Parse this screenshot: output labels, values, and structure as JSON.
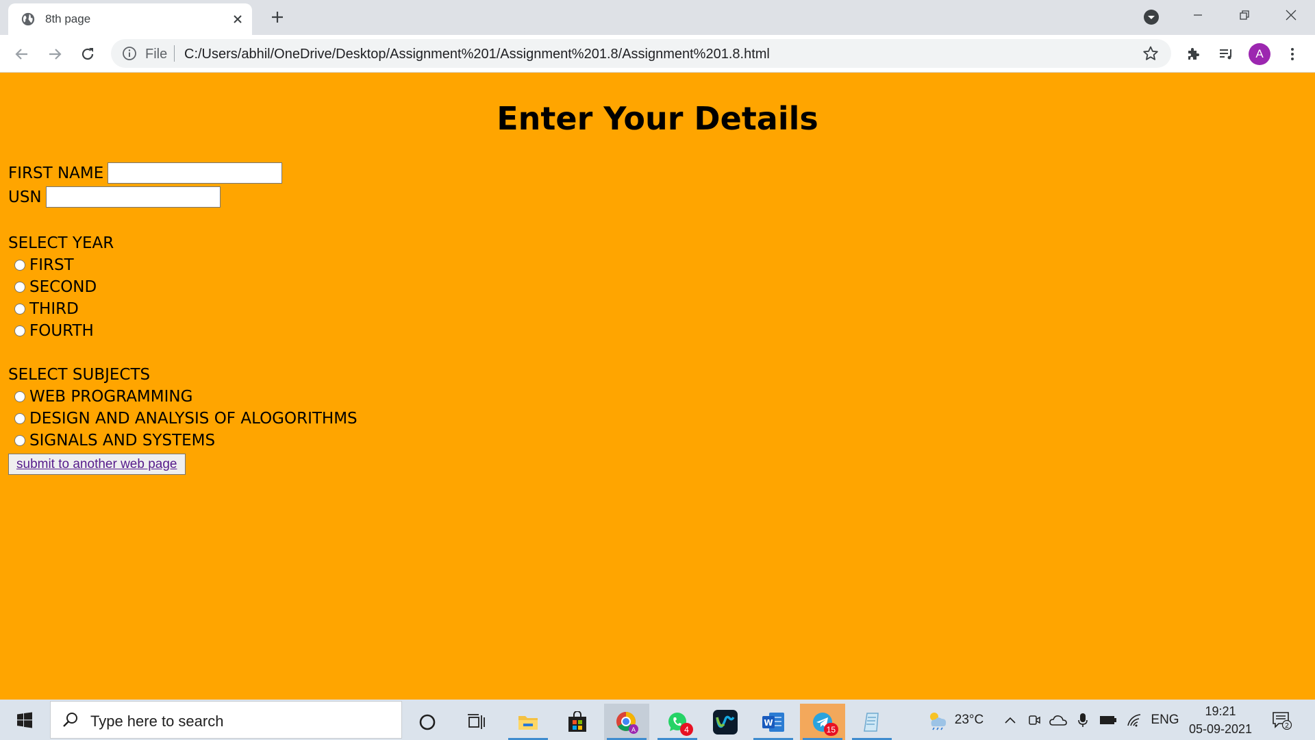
{
  "browser": {
    "tab": {
      "title": "8th page"
    },
    "address": {
      "scheme": "File",
      "url": "C:/Users/abhil/OneDrive/Desktop/Assignment%201/Assignment%201.8/Assignment%201.8.html"
    },
    "profile_initial": "A"
  },
  "page": {
    "heading": "Enter Your Details",
    "first_name_label": "FIRST NAME",
    "usn_label": "USN",
    "year_heading": "SELECT YEAR",
    "years": [
      "FIRST",
      "SECOND",
      "THIRD",
      "FOURTH"
    ],
    "subjects_heading": "SELECT SUBJECTS",
    "subjects": [
      "WEB PROGRAMMING",
      "DESIGN AND ANALYSIS OF ALOGORITHMS",
      "SIGNALS AND SYSTEMS"
    ],
    "submit_label": "submit to another web page",
    "background": "#ffa500"
  },
  "taskbar": {
    "search_placeholder": "Type here to search",
    "whatsapp_badge": "4",
    "telegram_badge": "15",
    "weather": "23°C",
    "language": "ENG",
    "time": "19:21",
    "date": "05-09-2021",
    "notifications": "2"
  }
}
